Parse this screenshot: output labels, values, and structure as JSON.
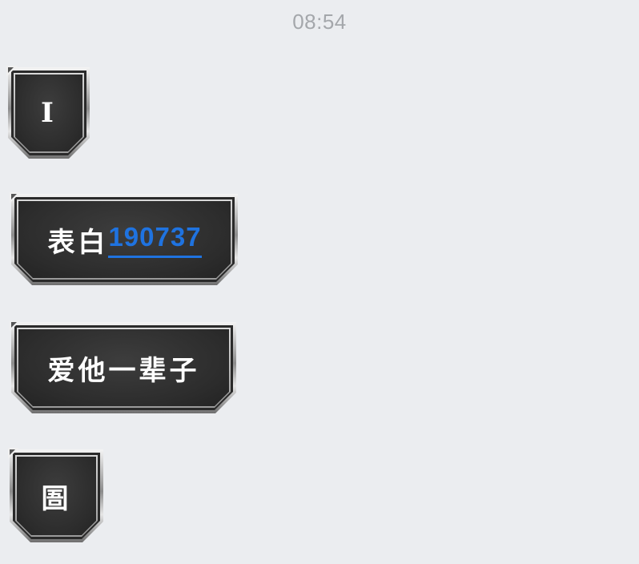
{
  "chat": {
    "timestamp": "08:54",
    "messages": [
      {
        "text": "I"
      },
      {
        "text": "表白",
        "link": "190737"
      },
      {
        "text": "爱他一辈子"
      },
      {
        "text": "圄"
      }
    ]
  },
  "colors": {
    "background": "#ebedf0",
    "bubble_face": "#2c2c2c",
    "link": "#1f73e0",
    "timestamp": "#a4a7ab"
  }
}
